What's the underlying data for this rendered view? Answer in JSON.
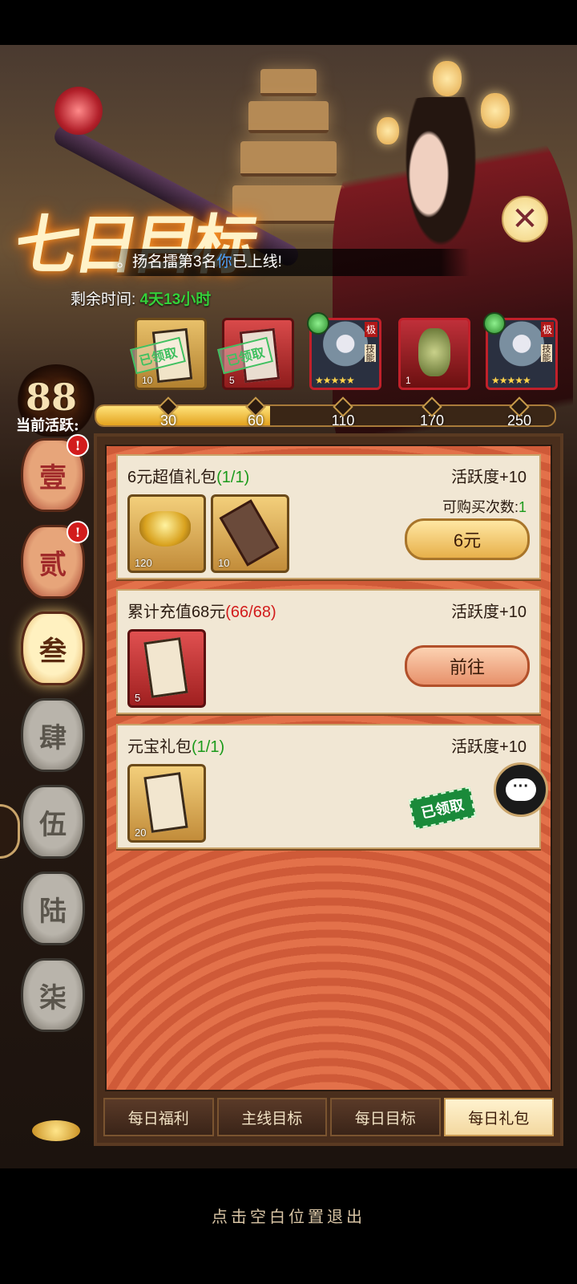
{
  "header": {
    "event_title": "七日目标",
    "close_icon": "close-x-icon",
    "marquee_prefix": "。扬名擂第3名",
    "marquee_you": "你",
    "marquee_suffix": "已上线!",
    "remaining_label": "剩余时间:",
    "remaining_value": "4天13小时"
  },
  "milestones": {
    "rewards": [
      {
        "type": "token",
        "count": "10",
        "status": "已领取"
      },
      {
        "type": "token-red",
        "count": "5",
        "status": "已领取"
      },
      {
        "type": "hero",
        "tag": "极",
        "sub": "技能"
      },
      {
        "type": "item",
        "count": "1"
      },
      {
        "type": "hero",
        "tag": "极",
        "sub": "技能"
      }
    ],
    "current_activity_value": "88",
    "current_activity_label": "当前活跃:",
    "ticks": [
      "30",
      "60",
      "110",
      "170",
      "250"
    ],
    "progress_fraction": 0.38
  },
  "side_tabs": [
    {
      "label": "壹",
      "badge": "!",
      "state": "normal"
    },
    {
      "label": "贰",
      "badge": "!",
      "state": "normal"
    },
    {
      "label": "叁",
      "badge": "",
      "state": "active"
    },
    {
      "label": "肆",
      "badge": "",
      "state": "locked"
    },
    {
      "label": "伍",
      "badge": "",
      "state": "locked"
    },
    {
      "label": "陆",
      "badge": "",
      "state": "locked"
    },
    {
      "label": "柒",
      "badge": "",
      "state": "locked"
    }
  ],
  "tasks": [
    {
      "name": "6元超值礼包",
      "progress": "(1/1)",
      "activity": "活跃度+10",
      "rewards": [
        {
          "icon": "gold-ingot-icon",
          "count": "120"
        },
        {
          "icon": "token-icon",
          "count": "10"
        }
      ],
      "buy_label": "可购买次数:",
      "buy_count": "1",
      "button": "6元"
    },
    {
      "name": "累计充值68元",
      "progress": "(66/68)",
      "activity": "活跃度+10",
      "rewards": [
        {
          "icon": "red-token-icon",
          "count": "5"
        }
      ],
      "button": "前往"
    },
    {
      "name": "元宝礼包",
      "progress": "(1/1)",
      "activity": "活跃度+10",
      "rewards": [
        {
          "icon": "token-icon",
          "count": "20"
        }
      ],
      "status": "已领取"
    }
  ],
  "bottom_tabs": [
    "每日福利",
    "主线目标",
    "每日目标",
    "每日礼包"
  ],
  "active_bottom_tab": "每日礼包",
  "exit_hint": "点击空白位置退出",
  "chat_icon": "chat-bubble-icon"
}
